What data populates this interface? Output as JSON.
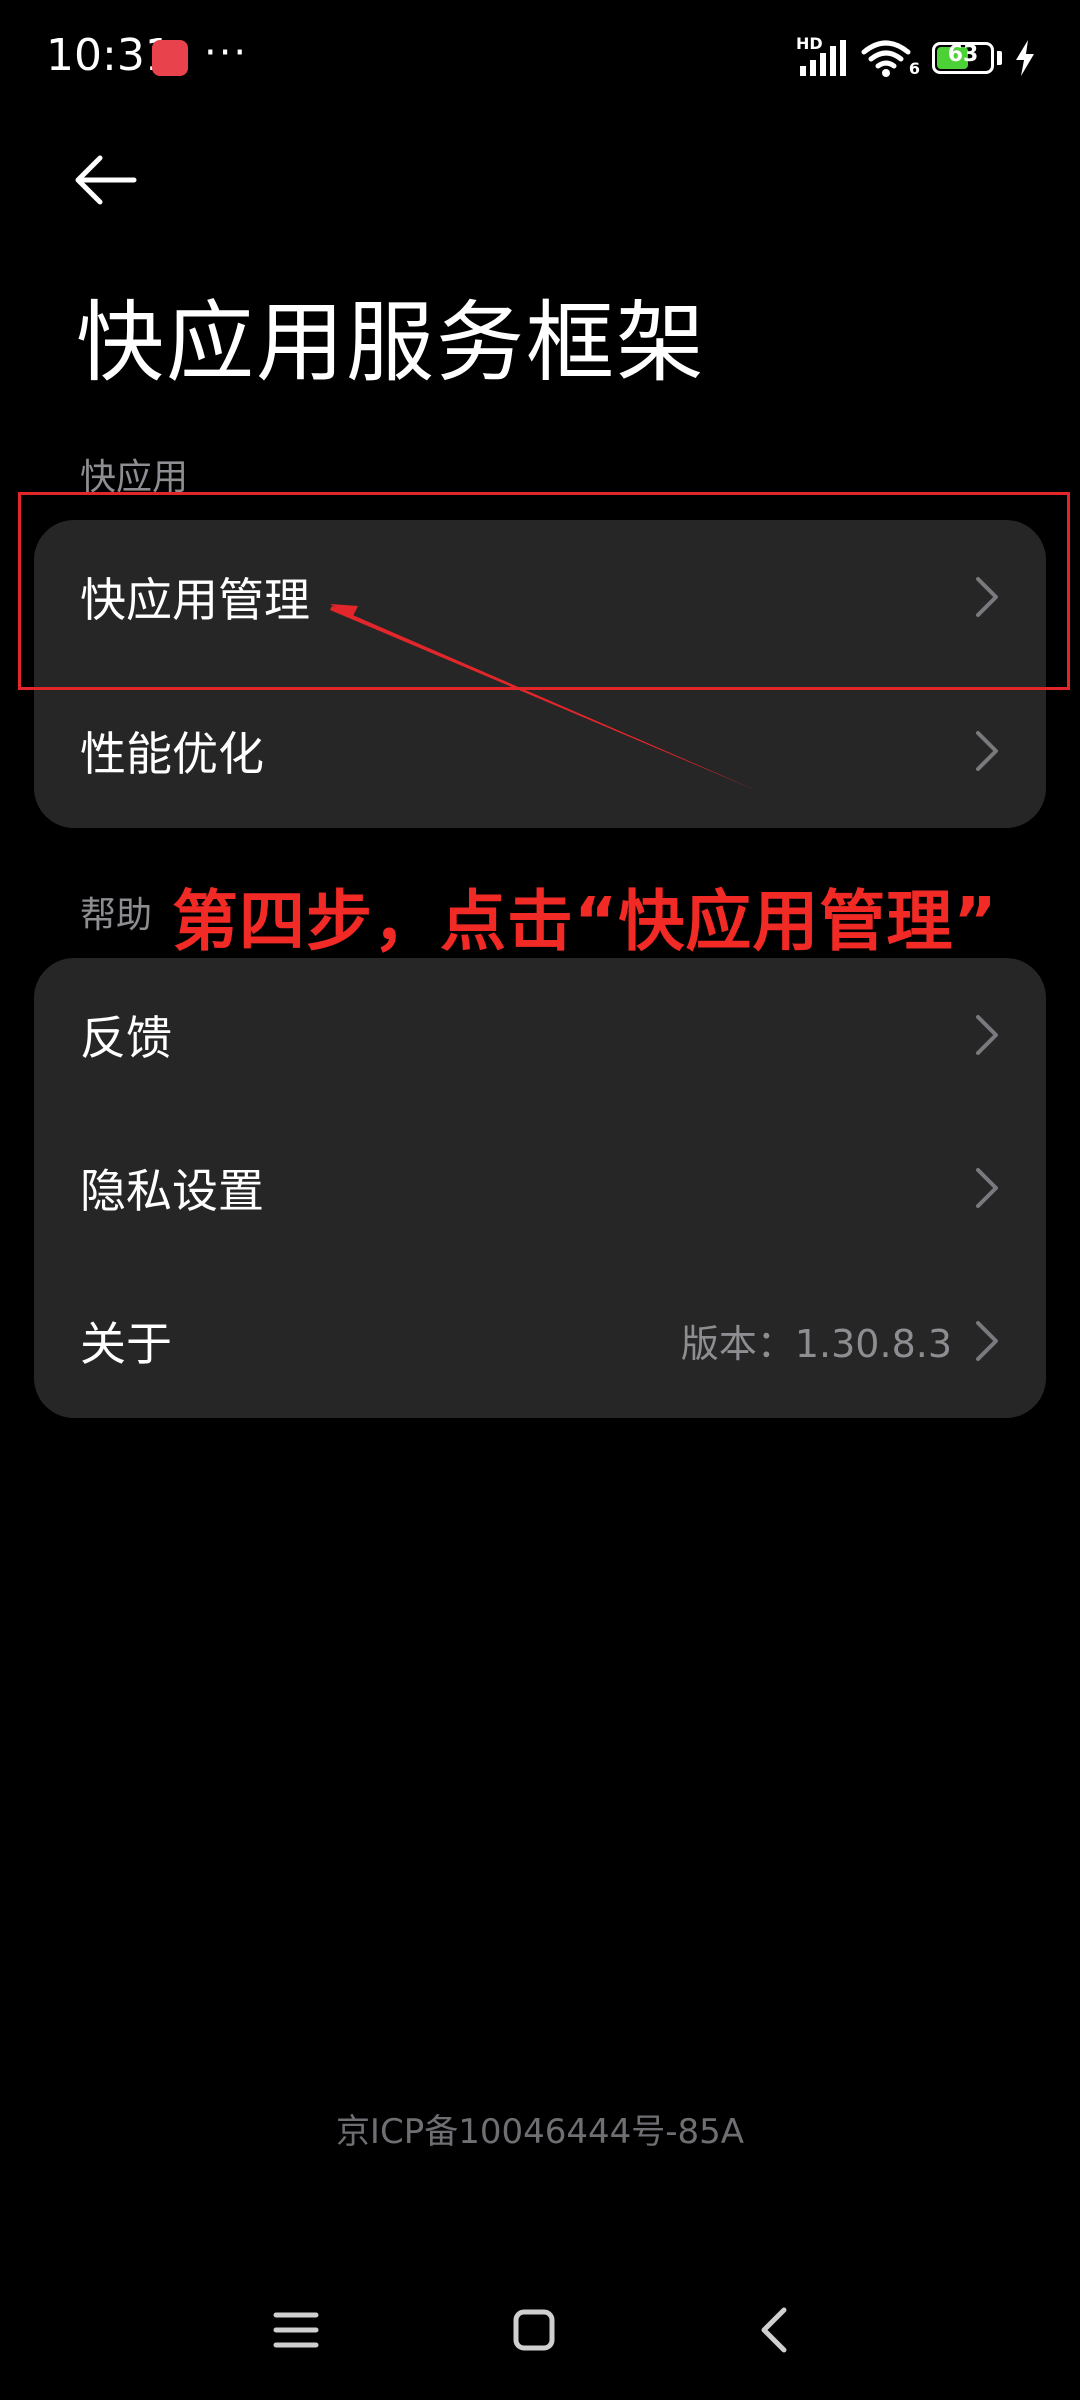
{
  "status_bar": {
    "time": "10:31",
    "more": "···",
    "network_label": "HD",
    "wifi_label": "6",
    "battery_level": "63",
    "battery_percent": 63
  },
  "header": {
    "title": "快应用服务框架"
  },
  "sections": [
    {
      "label": "快应用",
      "items": [
        {
          "label": "快应用管理"
        },
        {
          "label": "性能优化"
        }
      ]
    },
    {
      "label": "帮助",
      "items": [
        {
          "label": "反馈"
        },
        {
          "label": "隐私设置"
        },
        {
          "label": "关于",
          "value": "版本：1.30.8.3"
        }
      ]
    }
  ],
  "annotation": {
    "text": "第四步，点击“快应用管理”",
    "color": "#f22a25"
  },
  "footer": {
    "icp": "京ICP备10046444号-85A"
  },
  "colors": {
    "background": "#000000",
    "card": "#262626",
    "secondary_text": "#8d8d92",
    "battery": "#4cd137"
  }
}
